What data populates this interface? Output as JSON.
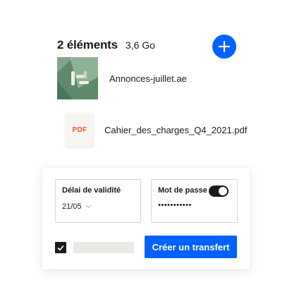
{
  "header": {
    "items_count": "2 éléments",
    "total_size": "3,6 Go"
  },
  "add_button": {
    "icon": "plus-icon",
    "color": "#0061fe"
  },
  "files": [
    {
      "name": "Annonces-juillet.ae",
      "thumbnail": "image-thumbnail"
    },
    {
      "name": "Cahier_des_charges_Q4_2021.pdf",
      "thumbnail_label": "PDF"
    }
  ],
  "settings": {
    "expiry": {
      "label": "Délai de validité",
      "value": "21/05",
      "icon": "chevron-down-icon"
    },
    "password": {
      "label": "Mot de passe",
      "masked_value": "•••••••••••",
      "toggle_on": true
    }
  },
  "footer": {
    "checkbox_checked": true,
    "transfer_button_label": "Créer un transfert"
  },
  "colors": {
    "accent": "#0061fe",
    "pdf_label": "#e8582a",
    "text": "#1e1919"
  }
}
